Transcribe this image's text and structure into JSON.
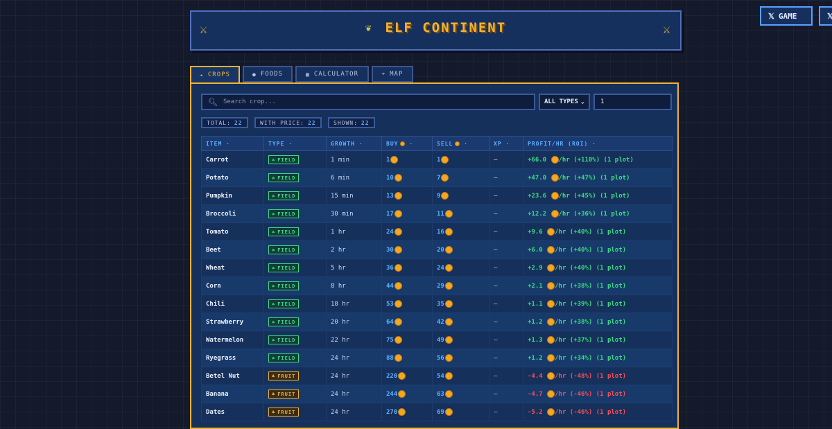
{
  "header": {
    "title": "ELF CONTINENT",
    "title_icon": "sprout-icon",
    "left_icon": "crossed-swords-icon",
    "right_icon": "crossed-swords-icon"
  },
  "social": {
    "game_label": "GAME"
  },
  "tabs": [
    {
      "label": "CROPS",
      "icon": "leaf-icon",
      "active": true
    },
    {
      "label": "FOODS",
      "icon": "dot-icon",
      "active": false
    },
    {
      "label": "CALCULATOR",
      "icon": "calculator-icon",
      "active": false
    },
    {
      "label": "MAP",
      "icon": "map-icon",
      "active": false
    }
  ],
  "filters": {
    "search_placeholder": "Search crop...",
    "type_select": "ALL TYPES",
    "quantity": "1"
  },
  "stats": [
    {
      "label": "TOTAL:",
      "value": "22"
    },
    {
      "label": "WITH PRICE:",
      "value": "22"
    },
    {
      "label": "SHOWN:",
      "value": "22"
    }
  ],
  "table": {
    "headers": [
      "ITEM",
      "TYPE",
      "GROWTH",
      "BUY",
      "SELL",
      "XP",
      "PROFIT/HR (ROI)"
    ],
    "sort_marker": "·",
    "rows": [
      {
        "item": "Carrot",
        "type": "FIELD",
        "growth": "1 min",
        "buy": "1",
        "sell": "1",
        "xp": "–",
        "profit": "+66.0",
        "profit_suffix": "/hr (+110%) (1 plot)",
        "sign": "pos"
      },
      {
        "item": "Potato",
        "type": "FIELD",
        "growth": "6 min",
        "buy": "10",
        "sell": "7",
        "xp": "–",
        "profit": "+47.0",
        "profit_suffix": "/hr (+47%) (1 plot)",
        "sign": "pos"
      },
      {
        "item": "Pumpkin",
        "type": "FIELD",
        "growth": "15 min",
        "buy": "13",
        "sell": "9",
        "xp": "–",
        "profit": "+23.6",
        "profit_suffix": "/hr (+45%) (1 plot)",
        "sign": "pos"
      },
      {
        "item": "Broccoli",
        "type": "FIELD",
        "growth": "30 min",
        "buy": "17",
        "sell": "11",
        "xp": "–",
        "profit": "+12.2",
        "profit_suffix": "/hr (+36%) (1 plot)",
        "sign": "pos"
      },
      {
        "item": "Tomato",
        "type": "FIELD",
        "growth": "1 hr",
        "buy": "24",
        "sell": "16",
        "xp": "–",
        "profit": "+9.6",
        "profit_suffix": "/hr (+40%) (1 plot)",
        "sign": "pos"
      },
      {
        "item": "Beet",
        "type": "FIELD",
        "growth": "2 hr",
        "buy": "30",
        "sell": "20",
        "xp": "–",
        "profit": "+6.0",
        "profit_suffix": "/hr (+40%) (1 plot)",
        "sign": "pos"
      },
      {
        "item": "Wheat",
        "type": "FIELD",
        "growth": "5 hr",
        "buy": "36",
        "sell": "24",
        "xp": "–",
        "profit": "+2.9",
        "profit_suffix": "/hr (+40%) (1 plot)",
        "sign": "pos"
      },
      {
        "item": "Corn",
        "type": "FIELD",
        "growth": "8 hr",
        "buy": "44",
        "sell": "29",
        "xp": "–",
        "profit": "+2.1",
        "profit_suffix": "/hr (+38%) (1 plot)",
        "sign": "pos"
      },
      {
        "item": "Chili",
        "type": "FIELD",
        "growth": "18 hr",
        "buy": "53",
        "sell": "35",
        "xp": "–",
        "profit": "+1.1",
        "profit_suffix": "/hr (+39%) (1 plot)",
        "sign": "pos"
      },
      {
        "item": "Strawberry",
        "type": "FIELD",
        "growth": "20 hr",
        "buy": "64",
        "sell": "42",
        "xp": "–",
        "profit": "+1.2",
        "profit_suffix": "/hr (+38%) (1 plot)",
        "sign": "pos"
      },
      {
        "item": "Watermelon",
        "type": "FIELD",
        "growth": "22 hr",
        "buy": "75",
        "sell": "49",
        "xp": "–",
        "profit": "+1.3",
        "profit_suffix": "/hr (+37%) (1 plot)",
        "sign": "pos"
      },
      {
        "item": "Ryegrass",
        "type": "FIELD",
        "growth": "24 hr",
        "buy": "88",
        "sell": "56",
        "xp": "–",
        "profit": "+1.2",
        "profit_suffix": "/hr (+34%) (1 plot)",
        "sign": "pos"
      },
      {
        "item": "Betel Nut",
        "type": "FRUIT",
        "growth": "24 hr",
        "buy": "220",
        "sell": "54",
        "xp": "–",
        "profit": "-4.4",
        "profit_suffix": "/hr (-48%) (1 plot)",
        "sign": "neg"
      },
      {
        "item": "Banana",
        "type": "FRUIT",
        "growth": "24 hr",
        "buy": "244",
        "sell": "63",
        "xp": "–",
        "profit": "-4.7",
        "profit_suffix": "/hr (-46%) (1 plot)",
        "sign": "neg"
      },
      {
        "item": "Dates",
        "type": "FRUIT",
        "growth": "24 hr",
        "buy": "270",
        "sell": "69",
        "xp": "–",
        "profit": "-5.2",
        "profit_suffix": "/hr (-46%) (1 plot)",
        "sign": "neg"
      }
    ]
  }
}
